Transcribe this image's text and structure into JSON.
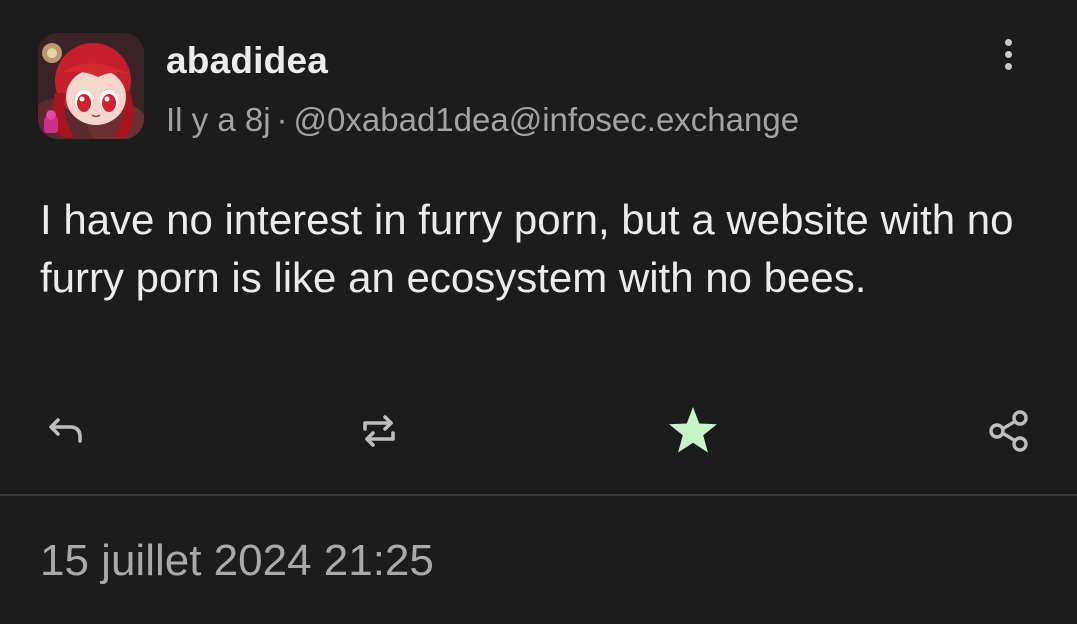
{
  "post": {
    "display_name": "abadidea",
    "relative_time": "Il y a 8j",
    "separator": "·",
    "handle": "@0xabad1dea@infosec.exchange",
    "content": "I have no interest in furry porn, but a website with no furry porn is like an ecosystem with no bees.",
    "timestamp": "15 juillet 2024 21:25"
  },
  "icons": {
    "more": "more-vertical-icon",
    "reply": "reply-icon",
    "boost": "boost-icon",
    "favourite": "star-icon",
    "share": "share-icon"
  },
  "colors": {
    "background": "#1c1c1c",
    "favourite_active": "#c8f5c8",
    "icon": "#bdbdbd",
    "secondary_text": "#a3a3a3"
  },
  "state": {
    "favourited": true
  }
}
